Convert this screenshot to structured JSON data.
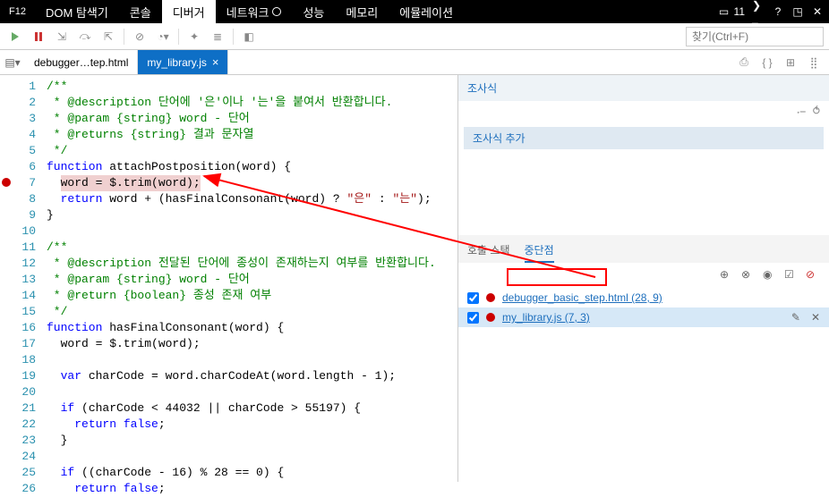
{
  "menubar": {
    "f12": "F12",
    "tabs": [
      {
        "label": "DOM 탐색기"
      },
      {
        "label": "콘솔"
      },
      {
        "label": "디버거",
        "active": true
      },
      {
        "label": "네트워크",
        "hasIndicator": true
      },
      {
        "label": "성능"
      },
      {
        "label": "메모리"
      },
      {
        "label": "에뮬레이션"
      }
    ],
    "errorCount": "11"
  },
  "toolbar": {
    "search_placeholder": "찾기(Ctrl+F)"
  },
  "filetabs": {
    "tabs": [
      {
        "label": "debugger…tep.html"
      },
      {
        "label": "my_library.js",
        "active": true
      }
    ]
  },
  "code": {
    "lines": [
      {
        "n": 1,
        "html": "<span class='c-comment'>/**</span>"
      },
      {
        "n": 2,
        "html": "<span class='c-comment'> * @description 단어에 '은'이나 '는'을 붙여서 반환합니다.</span>"
      },
      {
        "n": 3,
        "html": "<span class='c-comment'> * @param {string} word - 단어</span>"
      },
      {
        "n": 4,
        "html": "<span class='c-comment'> * @returns {string} 결과 문자열</span>"
      },
      {
        "n": 5,
        "html": "<span class='c-comment'> */</span>"
      },
      {
        "n": 6,
        "html": "<span class='c-kw'>function</span> attachPostposition(word) {"
      },
      {
        "n": 7,
        "html": "  <span class='line-hl'>word = $.trim(word);</span>",
        "bp": true
      },
      {
        "n": 8,
        "html": "  <span class='c-kw'>return</span> word + (hasFinalConsonant(word) ? <span class='c-str'>\"은\"</span> : <span class='c-str'>\"는\"</span>);"
      },
      {
        "n": 9,
        "html": "}"
      },
      {
        "n": 10,
        "html": ""
      },
      {
        "n": 11,
        "html": "<span class='c-comment'>/**</span>"
      },
      {
        "n": 12,
        "html": "<span class='c-comment'> * @description 전달된 단어에 종성이 존재하는지 여부를 반환합니다.</span>"
      },
      {
        "n": 13,
        "html": "<span class='c-comment'> * @param {string} word - 단어</span>"
      },
      {
        "n": 14,
        "html": "<span class='c-comment'> * @return {boolean} 종성 존재 여부</span>"
      },
      {
        "n": 15,
        "html": "<span class='c-comment'> */</span>"
      },
      {
        "n": 16,
        "html": "<span class='c-kw'>function</span> hasFinalConsonant(word) {"
      },
      {
        "n": 17,
        "html": "  word = $.trim(word);"
      },
      {
        "n": 18,
        "html": ""
      },
      {
        "n": 19,
        "html": "  <span class='c-kw'>var</span> charCode = word.charCodeAt(word.length - 1);"
      },
      {
        "n": 20,
        "html": ""
      },
      {
        "n": 21,
        "html": "  <span class='c-kw'>if</span> (charCode &lt; 44032 || charCode &gt; 55197) {"
      },
      {
        "n": 22,
        "html": "    <span class='c-kw'>return</span> <span class='c-kw'>false</span>;"
      },
      {
        "n": 23,
        "html": "  }"
      },
      {
        "n": 24,
        "html": ""
      },
      {
        "n": 25,
        "html": "  <span class='c-kw'>if</span> ((charCode - 16) % 28 == 0) {"
      },
      {
        "n": 26,
        "html": "    <span class='c-kw'>return</span> <span class='c-kw'>false</span>;"
      }
    ]
  },
  "right": {
    "watch": {
      "title": "조사식",
      "add": "조사식 추가"
    },
    "subtabs": {
      "callstack": "호출 스택",
      "breakpoints": "중단점"
    },
    "breakpoints": [
      {
        "file": "debugger_basic_step.html",
        "loc": "(28, 9)",
        "checked": true
      },
      {
        "file": "my_library.js",
        "loc": "(7, 3)",
        "checked": true,
        "selected": true,
        "boxed": true
      }
    ]
  }
}
